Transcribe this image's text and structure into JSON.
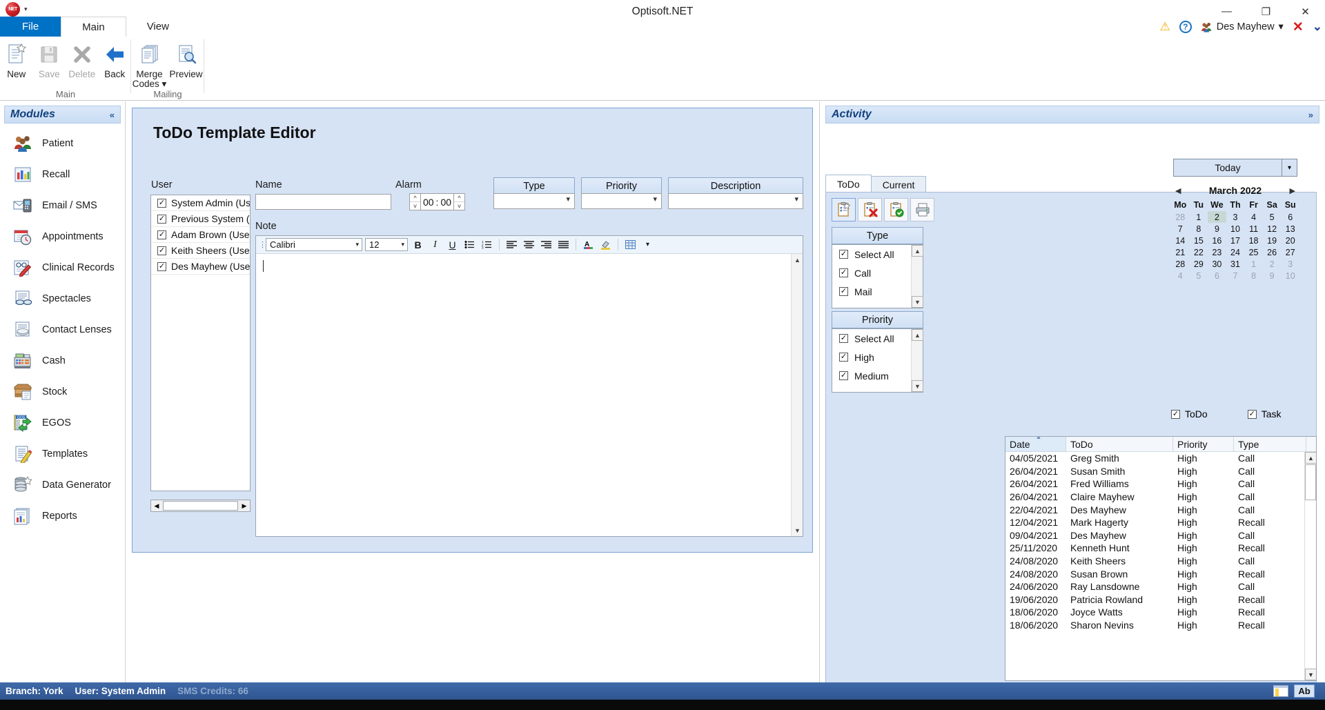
{
  "window": {
    "title": "Optisoft.NET",
    "qat_icon": "net-orb-icon",
    "qat_caret": "▾",
    "minimize": "—",
    "maximize": "❐",
    "close": "✕"
  },
  "ribbon": {
    "tabs": [
      {
        "label": "File",
        "state": "file"
      },
      {
        "label": "Main",
        "state": "active"
      },
      {
        "label": "View",
        "state": "normal"
      }
    ],
    "right": {
      "warning_icon": "warning-icon",
      "help_icon": "?",
      "user_label": "Des Mayhew",
      "user_caret": "▾",
      "close_x": "✕",
      "collapse_caret": "⌄"
    },
    "groups": [
      {
        "label": "Main",
        "buttons": [
          {
            "label": "New",
            "icon": "new-document-icon",
            "enabled": true
          },
          {
            "label": "Save",
            "icon": "save-floppy-icon",
            "enabled": false
          },
          {
            "label": "Delete",
            "icon": "delete-x-icon",
            "enabled": false
          },
          {
            "label": "Back",
            "icon": "back-arrow-icon",
            "enabled": true
          }
        ]
      },
      {
        "label": "Mailing",
        "buttons": [
          {
            "label": "Merge Codes ▾",
            "icon": "merge-codes-icon",
            "enabled": true
          },
          {
            "label": "Preview",
            "icon": "preview-magnifier-icon",
            "enabled": true
          }
        ]
      }
    ]
  },
  "sidebar": {
    "header": "Modules",
    "collapse": "«",
    "items": [
      {
        "label": "Patient",
        "icon": "patients-icon"
      },
      {
        "label": "Recall",
        "icon": "recall-chart-icon"
      },
      {
        "label": "Email / SMS",
        "icon": "email-sms-icon"
      },
      {
        "label": "Appointments",
        "icon": "appointments-calendar-clock-icon"
      },
      {
        "label": "Clinical Records",
        "icon": "clinical-records-icon"
      },
      {
        "label": "Spectacles",
        "icon": "spectacles-icon"
      },
      {
        "label": "Contact Lenses",
        "icon": "contact-lenses-icon"
      },
      {
        "label": "Cash",
        "icon": "cash-register-icon"
      },
      {
        "label": "Stock",
        "icon": "stock-box-icon"
      },
      {
        "label": "EGOS",
        "icon": "egos-icon"
      },
      {
        "label": "Templates",
        "icon": "templates-pencil-icon"
      },
      {
        "label": "Data Generator",
        "icon": "data-generator-icon"
      },
      {
        "label": "Reports",
        "icon": "reports-icon"
      }
    ]
  },
  "editor": {
    "title": "ToDo Template Editor",
    "user_label": "User",
    "users": [
      {
        "label": "System Admin (User)",
        "checked": true
      },
      {
        "label": "Previous System (Use",
        "checked": true
      },
      {
        "label": "Adam Brown (User)",
        "checked": true
      },
      {
        "label": "Keith Sheers (User)",
        "checked": true
      },
      {
        "label": "Des Mayhew (User)",
        "checked": true
      }
    ],
    "name_label": "Name",
    "name_value": "",
    "name_placeholder": "",
    "alarm_label": "Alarm",
    "alarm_hours": "00",
    "alarm_separator": ":",
    "alarm_minutes": "00",
    "type_header": "Type",
    "type_value": "",
    "priority_header": "Priority",
    "priority_value": "",
    "description_header": "Description",
    "description_value": "",
    "note_label": "Note",
    "note_value": "",
    "toolbar": {
      "font_family": "Calibri",
      "font_size": "12",
      "bold": "B",
      "italic": "I",
      "underline": "U",
      "bullet_list": "bullet-list-icon",
      "numbered_list": "numbered-list-icon",
      "align_left": "align-left-icon",
      "align_center": "align-center-icon",
      "align_right": "align-right-icon",
      "align_justify": "align-justify-icon",
      "font_color": "A",
      "highlight": "highlight-icon",
      "table": "table-icon",
      "table_caret": "▾"
    }
  },
  "activity": {
    "header": "Activity",
    "expand": "»",
    "tabs": [
      {
        "label": "ToDo",
        "active": true
      },
      {
        "label": "Current",
        "active": false
      }
    ],
    "toolbar": [
      {
        "icon": "new-todo-icon",
        "selected": true
      },
      {
        "icon": "delete-todo-icon",
        "selected": false
      },
      {
        "icon": "complete-todo-icon",
        "selected": false
      },
      {
        "icon": "print-icon",
        "selected": false
      }
    ],
    "type_filter": {
      "header": "Type",
      "options": [
        {
          "label": "Select All",
          "checked": true
        },
        {
          "label": "Call",
          "checked": true
        },
        {
          "label": "Mail",
          "checked": true
        }
      ]
    },
    "priority_filter": {
      "header": "Priority",
      "options": [
        {
          "label": "Select All",
          "checked": true
        },
        {
          "label": "High",
          "checked": true
        },
        {
          "label": "Medium",
          "checked": true
        }
      ]
    },
    "today_button": "Today",
    "today_caret": "▾",
    "calendar": {
      "month": "March 2022",
      "prev": "◀",
      "next": "▶",
      "dow": [
        "Mo",
        "Tu",
        "We",
        "Th",
        "Fr",
        "Sa",
        "Su"
      ],
      "weeks": [
        [
          {
            "d": "28",
            "o": true
          },
          {
            "d": "1"
          },
          {
            "d": "2",
            "sel": true
          },
          {
            "d": "3"
          },
          {
            "d": "4"
          },
          {
            "d": "5"
          },
          {
            "d": "6"
          }
        ],
        [
          {
            "d": "7"
          },
          {
            "d": "8"
          },
          {
            "d": "9"
          },
          {
            "d": "10"
          },
          {
            "d": "11"
          },
          {
            "d": "12"
          },
          {
            "d": "13"
          }
        ],
        [
          {
            "d": "14"
          },
          {
            "d": "15"
          },
          {
            "d": "16"
          },
          {
            "d": "17"
          },
          {
            "d": "18"
          },
          {
            "d": "19"
          },
          {
            "d": "20"
          }
        ],
        [
          {
            "d": "21"
          },
          {
            "d": "22"
          },
          {
            "d": "23"
          },
          {
            "d": "24"
          },
          {
            "d": "25"
          },
          {
            "d": "26"
          },
          {
            "d": "27"
          }
        ],
        [
          {
            "d": "28"
          },
          {
            "d": "29"
          },
          {
            "d": "30"
          },
          {
            "d": "31"
          },
          {
            "d": "1",
            "o": true
          },
          {
            "d": "2",
            "o": true
          },
          {
            "d": "3",
            "o": true
          }
        ],
        [
          {
            "d": "4",
            "o": true
          },
          {
            "d": "5",
            "o": true
          },
          {
            "d": "6",
            "o": true
          },
          {
            "d": "7",
            "o": true
          },
          {
            "d": "8",
            "o": true
          },
          {
            "d": "9",
            "o": true
          },
          {
            "d": "10",
            "o": true
          }
        ]
      ]
    },
    "toggles": [
      {
        "label": "ToDo",
        "checked": true
      },
      {
        "label": "Task",
        "checked": true
      }
    ],
    "grid": {
      "columns": [
        "Date",
        "ToDo",
        "Priority",
        "Type"
      ],
      "sorted_column": "Date",
      "rows": [
        [
          "04/05/2021",
          "Greg Smith",
          "High",
          "Call"
        ],
        [
          "26/04/2021",
          "Susan Smith",
          "High",
          "Call"
        ],
        [
          "26/04/2021",
          "Fred Williams",
          "High",
          "Call"
        ],
        [
          "26/04/2021",
          "Claire Mayhew",
          "High",
          "Call"
        ],
        [
          "22/04/2021",
          "Des Mayhew",
          "High",
          "Call"
        ],
        [
          "12/04/2021",
          "Mark Hagerty",
          "High",
          "Recall"
        ],
        [
          "09/04/2021",
          "Des Mayhew",
          "High",
          "Call"
        ],
        [
          "25/11/2020",
          "Kenneth Hunt",
          "High",
          "Recall"
        ],
        [
          "24/08/2020",
          "Keith Sheers",
          "High",
          "Call"
        ],
        [
          "24/08/2020",
          "Susan Brown",
          "High",
          "Recall"
        ],
        [
          "24/06/2020",
          "Ray Lansdowne",
          "High",
          "Call"
        ],
        [
          "19/06/2020",
          "Patricia Rowland",
          "High",
          "Recall"
        ],
        [
          "18/06/2020",
          "Joyce Watts",
          "High",
          "Recall"
        ],
        [
          "18/06/2020",
          "Sharon Nevins",
          "High",
          "Recall"
        ]
      ]
    }
  },
  "status": {
    "branch": "Branch: York",
    "user": "User: System Admin",
    "sms": "SMS Credits: 66",
    "page_icon": "page-indicator-icon",
    "ab_label": "Ab"
  },
  "colors": {
    "accent": "#0072c6",
    "panel_blue": "#d6e3f5",
    "header_blue": "#12407e",
    "status_bar": "#2f5490"
  }
}
